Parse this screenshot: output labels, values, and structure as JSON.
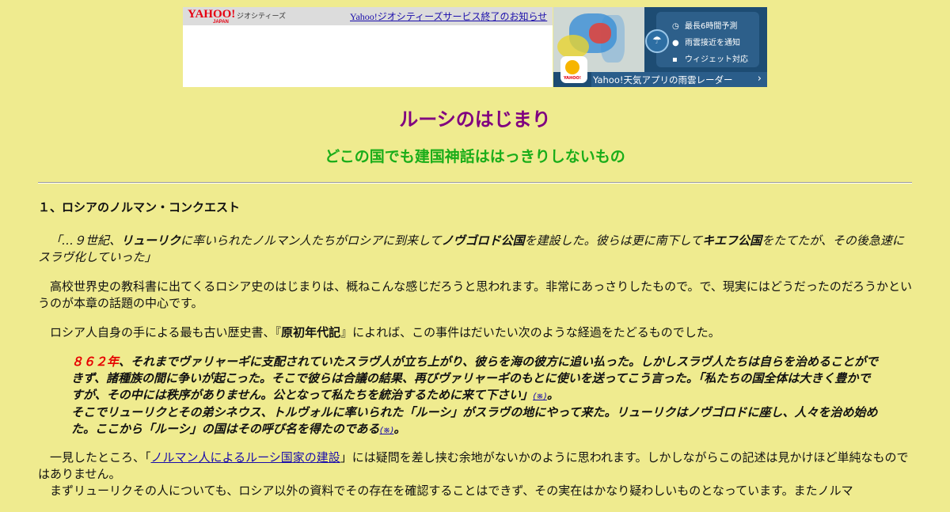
{
  "banner": {
    "yahoo_logo": "YAHOO!",
    "yahoo_logo_sub": "JAPAN",
    "service_name": "ジオシティーズ",
    "notice_link": "Yahoo!ジオシティーズサービス終了のお知らせ",
    "features": [
      {
        "icon": "clock-icon",
        "label": "最長6時間予測"
      },
      {
        "icon": "location-icon",
        "label": "雨雲接近を通知"
      },
      {
        "icon": "widget-icon",
        "label": "ウィジェット対応"
      }
    ],
    "app_icon_label": "YAHOO!",
    "promo_text": "Yahoo!天気アプリの雨雲レーダー",
    "promo_arrow": "›"
  },
  "page": {
    "title": "ルーシのはじまり",
    "subtitle": "どこの国でも建国神話ははっきりしないもの",
    "section_heading": "１、ロシアのノルマン・コンクエスト"
  },
  "quote": {
    "open": "「…９世紀、",
    "rurik": "リューリク",
    "t1": "に率いられたノルマン人たちがロシアに到来して",
    "novgorod": "ノヴゴロド公国",
    "t2": "を建設した。彼らは更に南下して",
    "kiev": "キエフ公国",
    "t3": "をたてたが、その後急速にスラヴ化していった」"
  },
  "para2": "高校世界史の教科書に出てくるロシア史のはじまりは、概ねこんな感じだろうと思われます。非常にあっさりしたもので。で、現実にはどうだったのだろうかというのが本章の話題の中心です。",
  "para3": {
    "before": "ロシア人自身の手による最も古い歴史書、『",
    "book": "原初年代記",
    "after": "』によれば、この事件はだいたい次のような経過をたどるものでした。"
  },
  "chronicle": {
    "year": "８６２年",
    "s1": "、それまでヴァリャーギに支配されていたスラヴ人が立ち上がり、彼らを海の彼方に追い払った。しかしスラヴ人たちは自らを治めることができず、諸種族の間に争いが起こった。そこで彼らは合議の結果、再びヴァリャーギのもとに使いを送ってこう言った。「私たちの国全体は大きく豊かですが、その中には秩序がありません。公となって私たちを統治するために来て下さい」",
    "note1": "(※)",
    "s1_end": "。",
    "s2": "そこでリューリクとその弟シネウス、トルヴォルに率いられた「ルーシ」がスラヴの地にやって来た。リューリクはノヴゴロドに座し、人々を治め始めた。ここから「ルーシ」の国はその呼び名を得たのである",
    "note2": "(※)",
    "s2_end": "。"
  },
  "para4": {
    "before": "一見したところ、「",
    "link": "ノルマン人によるルーシ国家の建設",
    "after": "」には疑問を差し挟む余地がないかのように思われます。しかしながらこの記述は見かけほど単純なものではありません。"
  },
  "para5": "まずリューリクその人についても、ロシア以外の資料でその存在を確認することはできず、その実在はかなり疑わしいものとなっています。またノルマ"
}
